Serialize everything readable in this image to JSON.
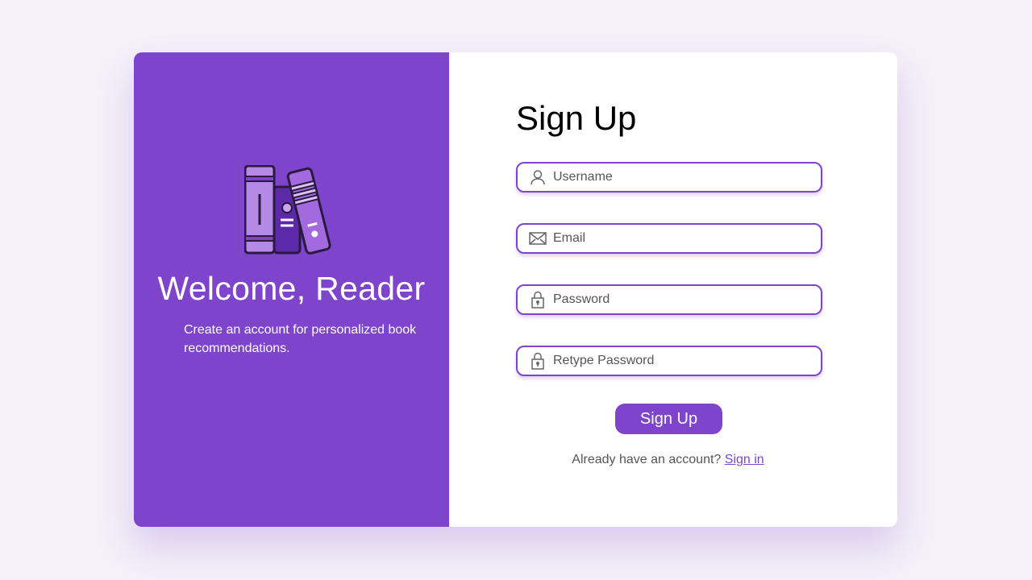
{
  "colors": {
    "accent": "#7e44cc",
    "page_background": "#f4f1f8",
    "card_background": "#ffffff"
  },
  "welcome_panel": {
    "illustration": "books-icon",
    "heading": "Welcome, Reader",
    "subtitle": "Create an account for personalized book recommendations."
  },
  "form": {
    "title": "Sign Up",
    "fields": [
      {
        "placeholder": "Username",
        "value": "",
        "icon": "user-icon"
      },
      {
        "placeholder": "Email",
        "value": "",
        "icon": "envelope-icon"
      },
      {
        "placeholder": "Password",
        "value": "",
        "icon": "lock-icon"
      },
      {
        "placeholder": "Retype Password",
        "value": "",
        "icon": "lock-icon"
      }
    ],
    "submit_label": "Sign Up",
    "footer_text": "Already have an account?",
    "signin_link": "Sign in"
  }
}
